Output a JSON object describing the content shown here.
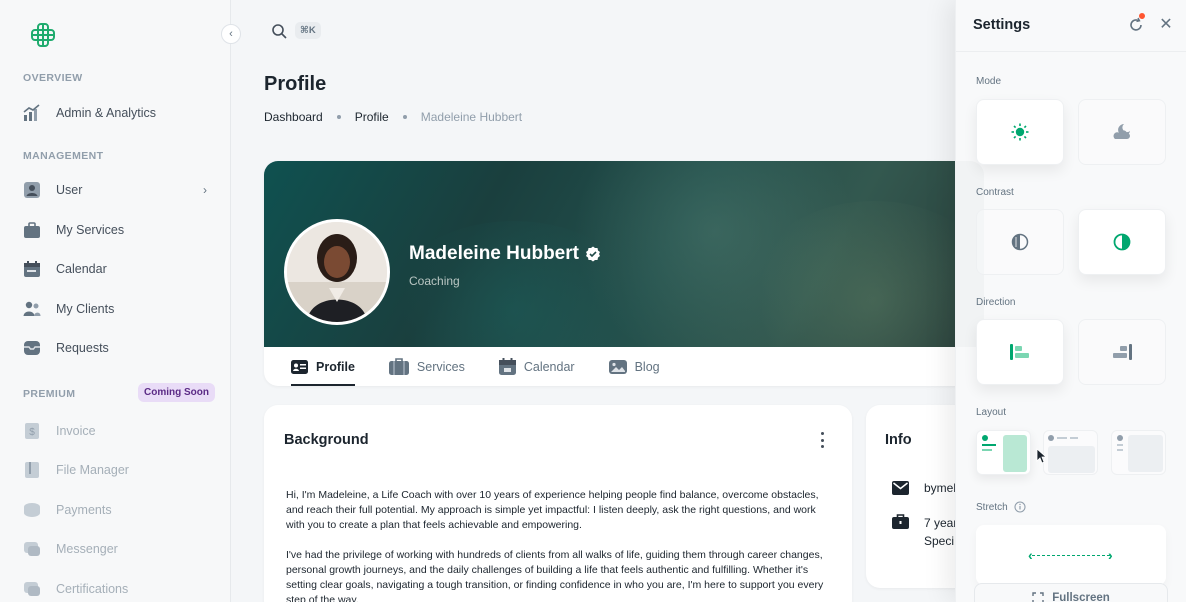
{
  "sidebar": {
    "sections": {
      "overview": "OVERVIEW",
      "management": "MANAGEMENT",
      "premium": "PREMIUM"
    },
    "coming_soon": "Coming Soon",
    "items": [
      {
        "label": "Admin & Analytics",
        "icon": "analytics-icon"
      },
      {
        "label": "User",
        "icon": "user-icon"
      },
      {
        "label": "My Services",
        "icon": "services-icon"
      },
      {
        "label": "Calendar",
        "icon": "calendar-icon"
      },
      {
        "label": "My Clients",
        "icon": "clients-icon"
      },
      {
        "label": "Requests",
        "icon": "requests-icon"
      },
      {
        "label": "Invoice",
        "icon": "invoice-icon"
      },
      {
        "label": "File Manager",
        "icon": "file-manager-icon"
      },
      {
        "label": "Payments",
        "icon": "payments-icon"
      },
      {
        "label": "Messenger",
        "icon": "messenger-icon"
      },
      {
        "label": "Certifications",
        "icon": "certifications-icon"
      }
    ]
  },
  "topbar": {
    "search_shortcut": "⌘K"
  },
  "page": {
    "title": "Profile",
    "breadcrumb": [
      "Dashboard",
      "Profile",
      "Madeleine Hubbert"
    ]
  },
  "profile": {
    "name": "Madeleine Hubbert",
    "role": "Coaching",
    "tabs": [
      {
        "label": "Profile",
        "icon": "profile-card-icon",
        "active": true
      },
      {
        "label": "Services",
        "icon": "briefcase-icon",
        "active": false
      },
      {
        "label": "Calendar",
        "icon": "calendar-icon",
        "active": false
      },
      {
        "label": "Blog",
        "icon": "blog-icon",
        "active": false
      }
    ]
  },
  "background": {
    "title": "Background",
    "paragraphs": [
      "Hi, I'm Madeleine, a Life Coach with over 10 years of experience helping people find balance, overcome obstacles, and reach their full potential. My approach is simple yet impactful: I listen deeply, ask the right questions, and work with you to create a plan that feels achievable and empowering.",
      "I've had the privilege of working with hundreds of clients from all walks of life, guiding them through career changes, personal growth journeys, and the daily challenges of building a life that feels authentic and fulfilling. Whether it's setting clear goals, navigating a tough transition, or finding confidence in who you are, I'm here to support you every step of the way."
    ]
  },
  "info": {
    "title": "Info",
    "email": "bymel",
    "experience_line1": "7 year",
    "experience_line2": "Speci"
  },
  "settings": {
    "title": "Settings",
    "mode_label": "Mode",
    "contrast_label": "Contrast",
    "direction_label": "Direction",
    "layout_label": "Layout",
    "stretch_label": "Stretch",
    "fullscreen_label": "Fullscreen",
    "accent_color": "#00a76f"
  }
}
